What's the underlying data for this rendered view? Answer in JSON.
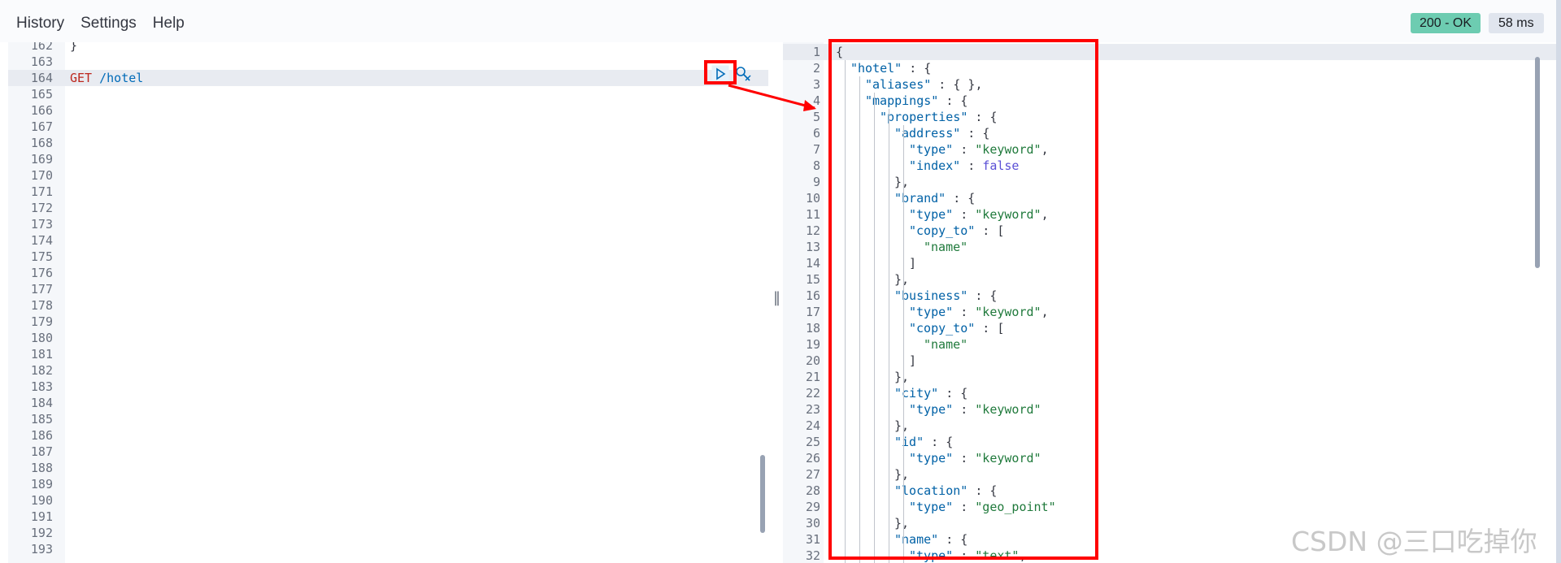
{
  "menu": {
    "items": [
      {
        "label": "History"
      },
      {
        "label": "Settings"
      },
      {
        "label": "Help"
      }
    ]
  },
  "status": {
    "code": "200 - OK",
    "time": "58 ms"
  },
  "request": {
    "lines": [
      {
        "num": "162",
        "text": "}"
      },
      {
        "num": "163",
        "text": ""
      },
      {
        "num": "164",
        "method": "GET",
        "path": "/hotel",
        "active": true
      },
      {
        "num": "165",
        "text": ""
      },
      {
        "num": "166",
        "text": ""
      },
      {
        "num": "167",
        "text": ""
      },
      {
        "num": "168",
        "text": ""
      },
      {
        "num": "169",
        "text": ""
      },
      {
        "num": "170",
        "text": ""
      },
      {
        "num": "171",
        "text": ""
      },
      {
        "num": "172",
        "text": ""
      },
      {
        "num": "173",
        "text": ""
      },
      {
        "num": "174",
        "text": ""
      },
      {
        "num": "175",
        "text": ""
      },
      {
        "num": "176",
        "text": ""
      },
      {
        "num": "177",
        "text": ""
      },
      {
        "num": "178",
        "text": ""
      },
      {
        "num": "179",
        "text": ""
      },
      {
        "num": "180",
        "text": ""
      },
      {
        "num": "181",
        "text": ""
      },
      {
        "num": "182",
        "text": ""
      },
      {
        "num": "183",
        "text": ""
      },
      {
        "num": "184",
        "text": ""
      },
      {
        "num": "185",
        "text": ""
      },
      {
        "num": "186",
        "text": ""
      },
      {
        "num": "187",
        "text": ""
      },
      {
        "num": "188",
        "text": ""
      },
      {
        "num": "189",
        "text": ""
      },
      {
        "num": "190",
        "text": ""
      },
      {
        "num": "191",
        "text": ""
      },
      {
        "num": "192",
        "text": ""
      },
      {
        "num": "193",
        "text": ""
      }
    ]
  },
  "response": {
    "lines": [
      {
        "num": "1",
        "indent": 0,
        "parts": [
          [
            "punct",
            "{"
          ]
        ]
      },
      {
        "num": "2",
        "indent": 1,
        "parts": [
          [
            "key",
            "\"hotel\""
          ],
          [
            "punct",
            " : {"
          ]
        ]
      },
      {
        "num": "3",
        "indent": 2,
        "parts": [
          [
            "key",
            "\"aliases\""
          ],
          [
            "punct",
            " : { },"
          ]
        ]
      },
      {
        "num": "4",
        "indent": 2,
        "parts": [
          [
            "key",
            "\"mappings\""
          ],
          [
            "punct",
            " : {"
          ]
        ]
      },
      {
        "num": "5",
        "indent": 3,
        "parts": [
          [
            "key",
            "\"properties\""
          ],
          [
            "punct",
            " : {"
          ]
        ]
      },
      {
        "num": "6",
        "indent": 4,
        "parts": [
          [
            "key",
            "\"address\""
          ],
          [
            "punct",
            " : {"
          ]
        ]
      },
      {
        "num": "7",
        "indent": 5,
        "parts": [
          [
            "key",
            "\"type\""
          ],
          [
            "punct",
            " : "
          ],
          [
            "str",
            "\"keyword\""
          ],
          [
            "punct",
            ","
          ]
        ]
      },
      {
        "num": "8",
        "indent": 5,
        "parts": [
          [
            "key",
            "\"index\""
          ],
          [
            "punct",
            " : "
          ],
          [
            "bool",
            "false"
          ]
        ]
      },
      {
        "num": "9",
        "indent": 4,
        "parts": [
          [
            "punct",
            "},"
          ]
        ]
      },
      {
        "num": "10",
        "indent": 4,
        "parts": [
          [
            "key",
            "\"brand\""
          ],
          [
            "punct",
            " : {"
          ]
        ]
      },
      {
        "num": "11",
        "indent": 5,
        "parts": [
          [
            "key",
            "\"type\""
          ],
          [
            "punct",
            " : "
          ],
          [
            "str",
            "\"keyword\""
          ],
          [
            "punct",
            ","
          ]
        ]
      },
      {
        "num": "12",
        "indent": 5,
        "parts": [
          [
            "key",
            "\"copy_to\""
          ],
          [
            "punct",
            " : ["
          ]
        ]
      },
      {
        "num": "13",
        "indent": 6,
        "parts": [
          [
            "str",
            "\"name\""
          ]
        ]
      },
      {
        "num": "14",
        "indent": 5,
        "parts": [
          [
            "punct",
            "]"
          ]
        ]
      },
      {
        "num": "15",
        "indent": 4,
        "parts": [
          [
            "punct",
            "},"
          ]
        ]
      },
      {
        "num": "16",
        "indent": 4,
        "parts": [
          [
            "key",
            "\"business\""
          ],
          [
            "punct",
            " : {"
          ]
        ]
      },
      {
        "num": "17",
        "indent": 5,
        "parts": [
          [
            "key",
            "\"type\""
          ],
          [
            "punct",
            " : "
          ],
          [
            "str",
            "\"keyword\""
          ],
          [
            "punct",
            ","
          ]
        ]
      },
      {
        "num": "18",
        "indent": 5,
        "parts": [
          [
            "key",
            "\"copy_to\""
          ],
          [
            "punct",
            " : ["
          ]
        ]
      },
      {
        "num": "19",
        "indent": 6,
        "parts": [
          [
            "str",
            "\"name\""
          ]
        ]
      },
      {
        "num": "20",
        "indent": 5,
        "parts": [
          [
            "punct",
            "]"
          ]
        ]
      },
      {
        "num": "21",
        "indent": 4,
        "parts": [
          [
            "punct",
            "},"
          ]
        ]
      },
      {
        "num": "22",
        "indent": 4,
        "parts": [
          [
            "key",
            "\"city\""
          ],
          [
            "punct",
            " : {"
          ]
        ]
      },
      {
        "num": "23",
        "indent": 5,
        "parts": [
          [
            "key",
            "\"type\""
          ],
          [
            "punct",
            " : "
          ],
          [
            "str",
            "\"keyword\""
          ]
        ]
      },
      {
        "num": "24",
        "indent": 4,
        "parts": [
          [
            "punct",
            "},"
          ]
        ]
      },
      {
        "num": "25",
        "indent": 4,
        "parts": [
          [
            "key",
            "\"id\""
          ],
          [
            "punct",
            " : {"
          ]
        ]
      },
      {
        "num": "26",
        "indent": 5,
        "parts": [
          [
            "key",
            "\"type\""
          ],
          [
            "punct",
            " : "
          ],
          [
            "str",
            "\"keyword\""
          ]
        ]
      },
      {
        "num": "27",
        "indent": 4,
        "parts": [
          [
            "punct",
            "},"
          ]
        ]
      },
      {
        "num": "28",
        "indent": 4,
        "parts": [
          [
            "key",
            "\"location\""
          ],
          [
            "punct",
            " : {"
          ]
        ]
      },
      {
        "num": "29",
        "indent": 5,
        "parts": [
          [
            "key",
            "\"type\""
          ],
          [
            "punct",
            " : "
          ],
          [
            "str",
            "\"geo_point\""
          ]
        ]
      },
      {
        "num": "30",
        "indent": 4,
        "parts": [
          [
            "punct",
            "},"
          ]
        ]
      },
      {
        "num": "31",
        "indent": 4,
        "parts": [
          [
            "key",
            "\"name\""
          ],
          [
            "punct",
            " : {"
          ]
        ]
      },
      {
        "num": "32",
        "indent": 5,
        "parts": [
          [
            "key",
            "\"type\""
          ],
          [
            "punct",
            " : "
          ],
          [
            "str",
            "\"text\""
          ],
          [
            "punct",
            ","
          ]
        ]
      }
    ]
  },
  "watermark": "CSDN @三口吃掉你",
  "colors": {
    "highlight": "#ff0000",
    "status_ok": "#6dccb1"
  }
}
